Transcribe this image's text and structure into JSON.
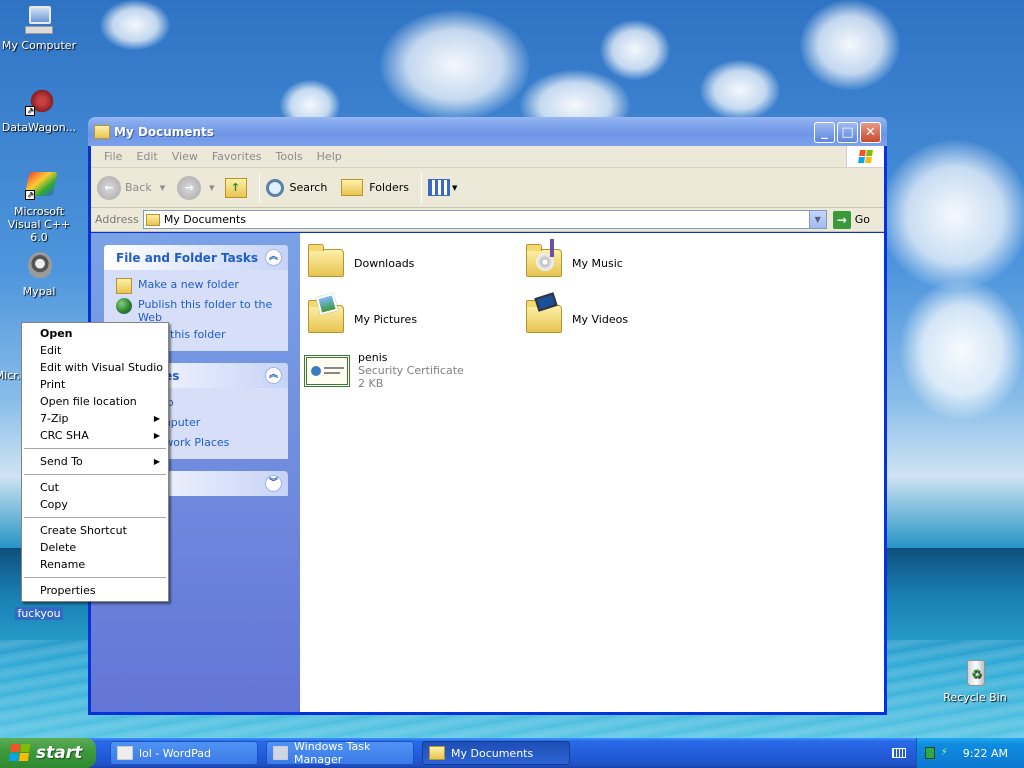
{
  "desktop": {
    "icons": [
      {
        "label": "My Computer"
      },
      {
        "label": "DataWagon..."
      },
      {
        "label": "Microsoft Visual C++ 6.0"
      },
      {
        "label": "Mypal"
      },
      {
        "label": "Micr..."
      },
      {
        "label": "fuckyou"
      },
      {
        "label": "Recycle Bin"
      }
    ]
  },
  "window": {
    "title": "My Documents",
    "menu": [
      "File",
      "Edit",
      "View",
      "Favorites",
      "Tools",
      "Help"
    ],
    "toolbar": {
      "back_label": "Back",
      "search_label": "Search",
      "folders_label": "Folders"
    },
    "address": {
      "label": "Address",
      "value": "My Documents",
      "go_label": "Go"
    },
    "tasks_panel": {
      "title": "File and Folder Tasks",
      "items": [
        "Make a new folder",
        "Publish this folder to the Web",
        "this folder"
      ]
    },
    "places_panel": {
      "title": "ces",
      "items": [
        "op",
        "mputer",
        "twork Places"
      ]
    },
    "files": [
      {
        "name": "Downloads"
      },
      {
        "name": "My Music"
      },
      {
        "name": "My Pictures"
      },
      {
        "name": "My Videos"
      },
      {
        "name": "penis",
        "type": "Security Certificate",
        "size": "2 KB"
      }
    ]
  },
  "context_menu": {
    "items": [
      {
        "label": "Open"
      },
      {
        "label": "Edit"
      },
      {
        "label": "Edit with Visual Studio"
      },
      {
        "label": "Print"
      },
      {
        "label": "Open file location"
      },
      {
        "label": "7-Zip"
      },
      {
        "label": "CRC SHA"
      },
      {
        "label": "Send To"
      },
      {
        "label": "Cut"
      },
      {
        "label": "Copy"
      },
      {
        "label": "Create Shortcut"
      },
      {
        "label": "Delete"
      },
      {
        "label": "Rename"
      },
      {
        "label": "Properties"
      }
    ]
  },
  "taskbar": {
    "start_label": "start",
    "tasks": [
      {
        "label": "lol - WordPad"
      },
      {
        "label": "Windows Task Manager"
      },
      {
        "label": "My Documents"
      }
    ],
    "clock": "9:22 AM"
  },
  "colors": {
    "title_blue": "#0831d9",
    "link_blue": "#215dc6",
    "taskbar_blue": "#245edb",
    "start_green": "#3c9a3c"
  }
}
